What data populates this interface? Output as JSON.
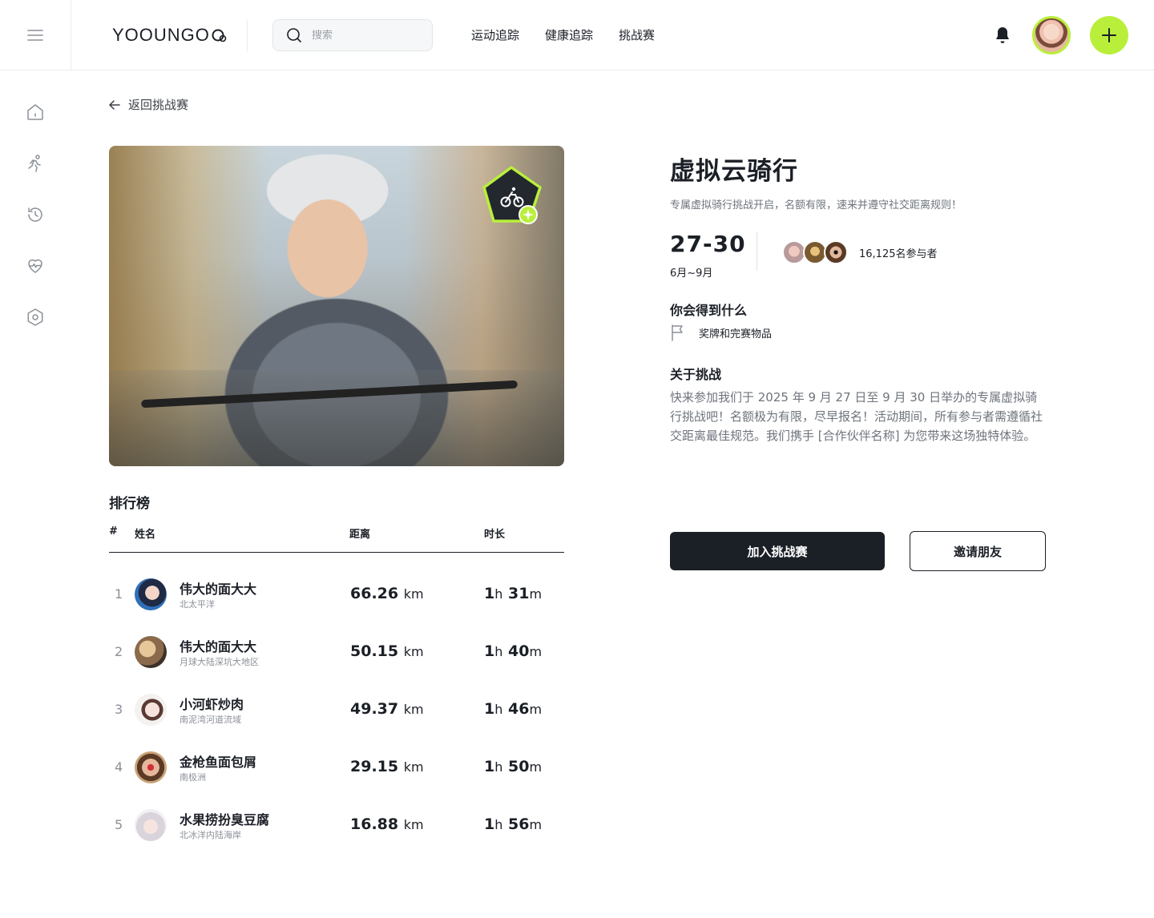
{
  "brand": {
    "logo_text": "YOOUNGO",
    "accent": "#b9ef3a",
    "dark": "#1b1f26"
  },
  "header": {
    "search_placeholder": "搜索",
    "nav": [
      "运动追踪",
      "健康追踪",
      "挑战赛"
    ],
    "icons": {
      "menu": "hamburger-menu-icon",
      "search": "search-icon",
      "bell": "bell-icon",
      "add": "plus-icon"
    }
  },
  "sidebar": {
    "items": [
      {
        "icon": "home-icon"
      },
      {
        "icon": "running-icon"
      },
      {
        "icon": "history-icon"
      },
      {
        "icon": "heart-rate-icon"
      },
      {
        "icon": "settings-hexagon-icon"
      }
    ]
  },
  "back_link": {
    "label": "返回挑战赛",
    "icon": "arrow-left-icon"
  },
  "challenge": {
    "title": "虚拟云骑行",
    "subtitle": "专属虚拟骑行挑战开启，名额有限，速来并遵守社交距离规则！",
    "dates": "27-30",
    "months": "6月~9月",
    "participants_label": "16,125名参与者",
    "reward_heading": "你会得到什么",
    "reward_item": "奖牌和完赛物品",
    "about_heading": "关于挑战",
    "about_text": "快来参加我们于 2025 年 9 月 27 日至 9 月 30 日举办的专属虚拟骑行挑战吧！名额极为有限，尽早报名！活动期间，所有参与者需遵循社交距离最佳规范。我们携手 [合作伙伴名称] 为您带来这场独特体验。",
    "join_label": "加入挑战赛",
    "invite_label": "邀请朋友"
  },
  "leaderboard": {
    "title": "排行榜",
    "columns": {
      "rank": "#",
      "name": "姓名",
      "distance": "距离",
      "duration": "时长"
    },
    "rows": [
      {
        "rank": "1",
        "name": "伟大的面大大",
        "location": "北太平洋",
        "distance": "66.26",
        "unit": "km",
        "h": "1",
        "h_unit": "h",
        "m": "31",
        "m_unit": "m"
      },
      {
        "rank": "2",
        "name": "伟大的面大大",
        "location": "月球大陆深坑大地区",
        "distance": "50.15",
        "unit": "km",
        "h": "1",
        "h_unit": "h",
        "m": "40",
        "m_unit": "m"
      },
      {
        "rank": "3",
        "name": "小河虾炒肉",
        "location": "南泥湾河道流域",
        "distance": "49.37",
        "unit": "km",
        "h": "1",
        "h_unit": "h",
        "m": "46",
        "m_unit": "m"
      },
      {
        "rank": "4",
        "name": "金枪鱼面包屑",
        "location": "南极洲",
        "distance": "29.15",
        "unit": "km",
        "h": "1",
        "h_unit": "h",
        "m": "50",
        "m_unit": "m"
      },
      {
        "rank": "5",
        "name": "水果捞扮臭豆腐",
        "location": "北冰洋内陆海岸",
        "distance": "16.88",
        "unit": "km",
        "h": "1",
        "h_unit": "h",
        "m": "56",
        "m_unit": "m"
      }
    ]
  }
}
